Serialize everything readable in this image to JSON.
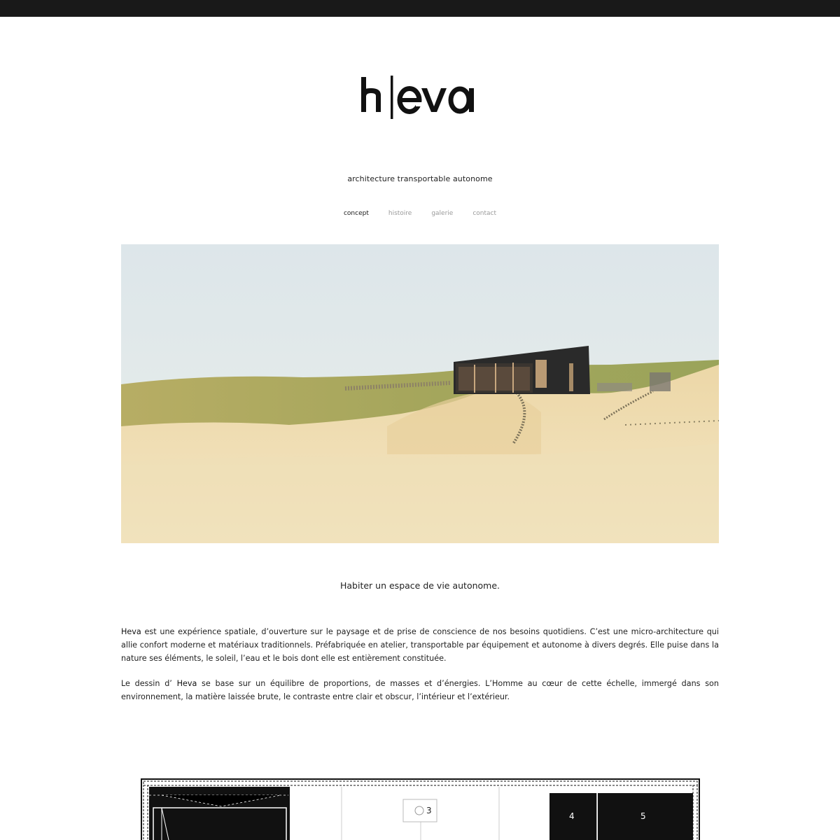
{
  "site": {
    "brand": "heva",
    "tagline": "architecture transportable autonome"
  },
  "nav": {
    "items": [
      {
        "label": "concept",
        "active": true
      },
      {
        "label": "histoire",
        "active": false
      },
      {
        "label": "galerie",
        "active": false
      },
      {
        "label": "contact",
        "active": false
      }
    ]
  },
  "hero": {
    "alt": "Maison Heva sur une dune de sable"
  },
  "content": {
    "headline": "Habiter un espace de vie autonome.",
    "p1_name": "Heva",
    "p1_text": " est une expérience spatiale, d’ouverture sur le paysage et de prise de conscience de nos besoins quotidiens. C’est une micro-architecture qui allie confort moderne et matériaux traditionnels.  Préfabriquée en atelier, transportable par équipement et autonome à divers degrés.  Elle puise dans la nature ses éléments, le soleil, l’eau et le bois dont elle est entièrement constituée.",
    "p2_prefix": "Le dessin d’ ",
    "p2_name": "Heva",
    "p2_text": " se base sur un équilibre de proportions, de masses et d’énergies.  L’Homme au cœur de cette échelle, immergé dans son environnement, la matière laissée brute, le contraste entre clair et obscur, l’intérieur et l’extérieur."
  },
  "plan": {
    "labels": [
      "3",
      "4",
      "5"
    ]
  },
  "colors": {
    "topbar": "#191919",
    "nav_active": "#1a1a1a",
    "nav_inactive": "#9a9a9a"
  }
}
